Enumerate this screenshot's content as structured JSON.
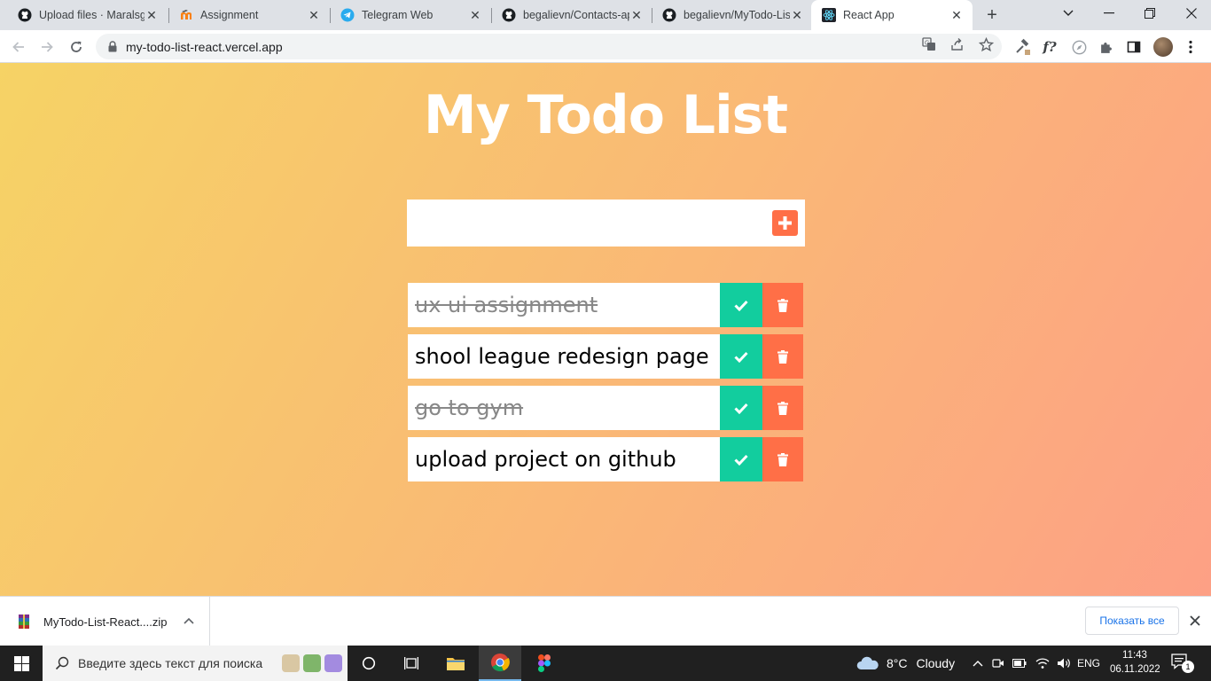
{
  "browser": {
    "tabs": [
      {
        "title": "Upload files · Maralsgi",
        "icon": "github-icon"
      },
      {
        "title": "Assignment",
        "icon": "moodle-icon"
      },
      {
        "title": "Telegram Web",
        "icon": "telegram-icon"
      },
      {
        "title": "begalievn/Contacts-ap",
        "icon": "github-icon"
      },
      {
        "title": "begalievn/MyTodo-Lis",
        "icon": "github-icon"
      },
      {
        "title": "React App",
        "icon": "react-icon",
        "active": true
      }
    ],
    "url": "my-todo-list-react.vercel.app"
  },
  "app": {
    "title": "My Todo List",
    "input_value": "",
    "colors": {
      "gradient_start": "#f6d365",
      "gradient_end": "#fda085",
      "complete": "#12cd9e",
      "trash": "#ff6f47"
    },
    "todos": [
      {
        "text": "ux ui assignment",
        "completed": true
      },
      {
        "text": "shool league redesign page",
        "completed": false
      },
      {
        "text": "go to gym",
        "completed": true
      },
      {
        "text": "upload project on github",
        "completed": false
      }
    ]
  },
  "downloads": {
    "file_name": "MyTodo-List-React....zip",
    "show_all_label": "Показать все"
  },
  "taskbar": {
    "search_placeholder": "Введите здесь текст для поиска",
    "weather_temp": "8°C",
    "weather_text": "Cloudy",
    "language": "ENG",
    "time": "11:43",
    "date": "06.11.2022",
    "notification_count": "1"
  }
}
